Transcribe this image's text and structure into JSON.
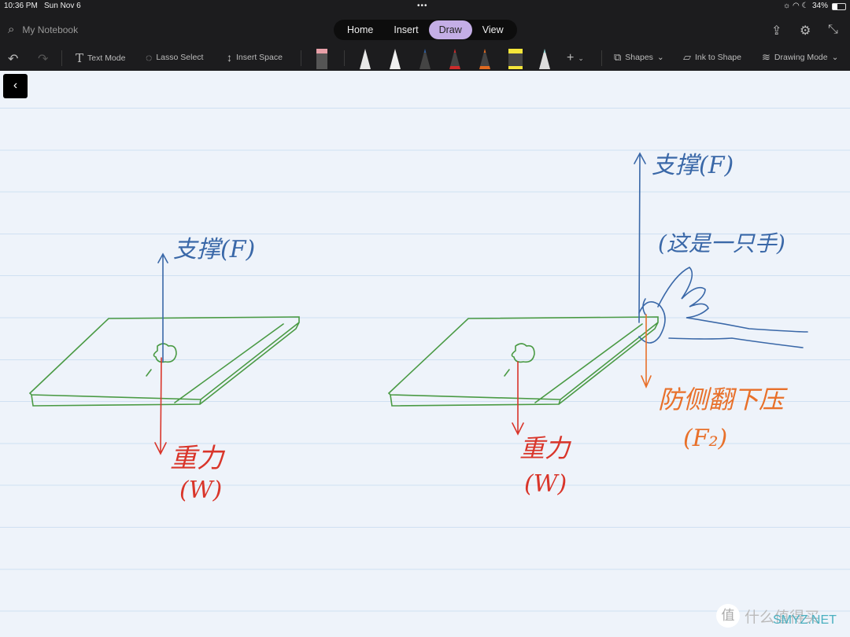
{
  "status_bar": {
    "time": "10:36 PM",
    "date": "Sun Nov 6",
    "battery": "34%"
  },
  "header": {
    "notebook": "My Notebook",
    "tabs": [
      {
        "label": "Home"
      },
      {
        "label": "Insert"
      },
      {
        "label": "Draw",
        "active": true
      },
      {
        "label": "View"
      }
    ]
  },
  "toolbar": {
    "text_mode": "Text Mode",
    "lasso": "Lasso Select",
    "insert_space": "Insert Space",
    "shapes": "Shapes",
    "ink_to_shape": "Ink to Shape",
    "drawing_mode": "Drawing Mode",
    "pens": [
      {
        "color": "#e8e8e8"
      },
      {
        "color": "#f0f0f0"
      },
      {
        "color": "#2f5f9e"
      },
      {
        "color": "#cc2b2b"
      },
      {
        "color": "#e06a20"
      },
      {
        "color": "#f5e63a"
      },
      {
        "color": "#8fd0d0"
      }
    ]
  },
  "ink": {
    "left": {
      "support": "支撑(F)",
      "gravity": "重力",
      "gravity_sym": "(W)"
    },
    "right": {
      "support": "支撑(F)",
      "hand_note": "(这是一只手)",
      "gravity": "重力",
      "gravity_sym": "(W)",
      "press": "防侧翻下压",
      "press_sym": "(F₂)"
    },
    "colors": {
      "blue": "#3a68a8",
      "red": "#d9352a",
      "orange": "#e8702a",
      "green": "#4a9a44"
    }
  },
  "watermark": {
    "logo": "值",
    "text": "什么值得买",
    "url": "SMYZ.NET"
  }
}
